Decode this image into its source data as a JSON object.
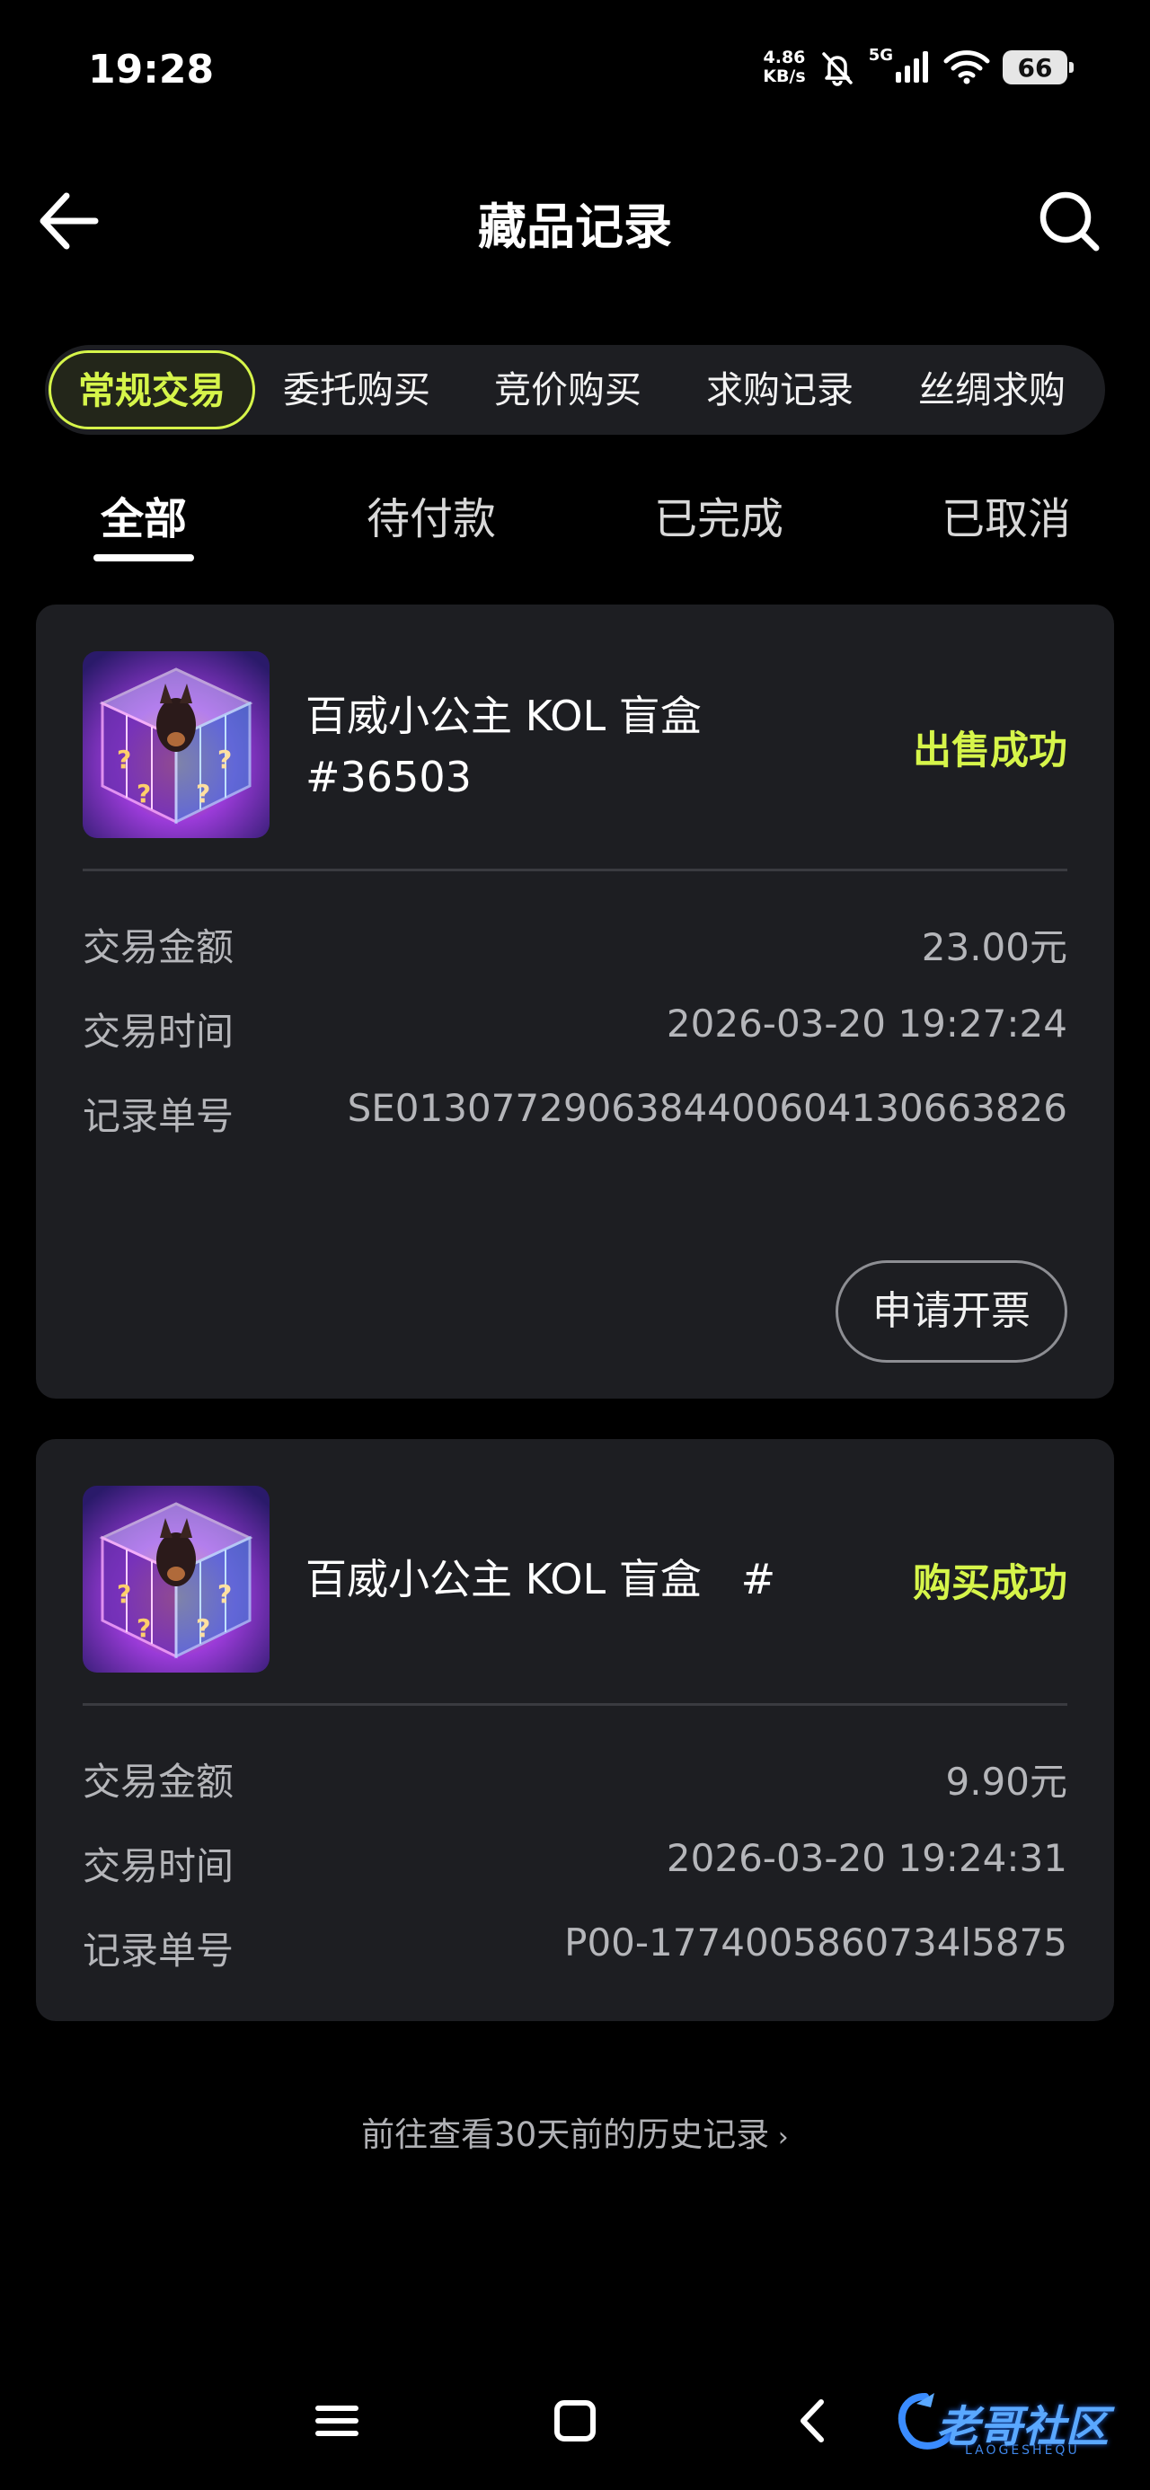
{
  "status_bar": {
    "time": "19:28",
    "net_speed_value": "4.86",
    "net_speed_unit": "KB/s",
    "network": "5G",
    "battery": "66"
  },
  "header": {
    "title": "藏品记录",
    "back_icon": "arrow-left-icon",
    "search_icon": "search-icon"
  },
  "category_tabs": [
    {
      "label": "常规交易",
      "active": true
    },
    {
      "label": "委托购买",
      "active": false
    },
    {
      "label": "竞价购买",
      "active": false
    },
    {
      "label": "求购记录",
      "active": false
    },
    {
      "label": "丝绸求购",
      "active": false
    }
  ],
  "status_tabs": [
    {
      "label": "全部",
      "active": true
    },
    {
      "label": "待付款",
      "active": false
    },
    {
      "label": "已完成",
      "active": false
    },
    {
      "label": "已取消",
      "active": false
    }
  ],
  "labels": {
    "amount": "交易金额",
    "time": "交易时间",
    "record_no": "记录单号"
  },
  "records": [
    {
      "name_line1": "百威小公主 KOL 盲盒",
      "name_line2": "#36503",
      "status": "出售成功",
      "amount": "23.00元",
      "time": "2026-03-20 19:27:24",
      "record_no": "SE0130772906384400604130663826",
      "invoice_button": "申请开票"
    },
    {
      "name_line1": "百威小公主 KOL 盲盒   #",
      "status": "购买成功",
      "amount": "9.90元",
      "time": "2026-03-20 19:24:31",
      "record_no": "P00-1774005860734l5875"
    }
  ],
  "history_link": "前往查看30天前的历史记录",
  "nav": {
    "menu_icon": "menu-icon",
    "home_icon": "home-square-icon",
    "back_icon": "back-chevron-icon"
  },
  "watermark": {
    "text": "老哥社区",
    "sub": "LAOGESHEQU"
  },
  "colors": {
    "accent": "#d6f54a",
    "card_bg": "#1d1e22",
    "background": "#000000"
  }
}
